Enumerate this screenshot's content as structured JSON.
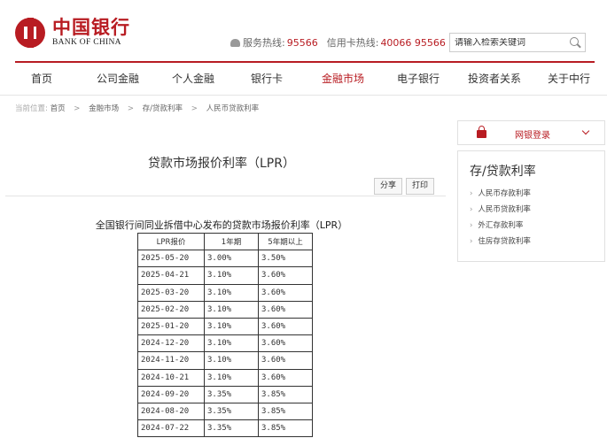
{
  "header": {
    "logo_cn": "中国银行",
    "logo_en": "BANK OF CHINA",
    "service_label": "服务热线:",
    "service_number": "95566",
    "card_label": "信用卡热线:",
    "card_number": "40066 95566",
    "search_placeholder": "请输入检索关键词"
  },
  "nav": [
    "首页",
    "公司金融",
    "个人金融",
    "银行卡",
    "金融市场",
    "电子银行",
    "投资者关系",
    "关于中行"
  ],
  "breadcrumb": {
    "prefix": "当前位置:",
    "items": [
      "首页",
      "金融市场",
      "存/贷款利率",
      "人民币贷款利率"
    ]
  },
  "main": {
    "title": "贷款市场报价利率（LPR）",
    "share": "分享",
    "print": "打印",
    "table_caption": "全国银行间同业拆借中心发布的贷款市场报价利率（LPR）",
    "headers": [
      "LPR报价",
      "1年期",
      "5年期以上"
    ],
    "rows": [
      [
        "2025-05-20",
        "3.00%",
        "3.50%"
      ],
      [
        "2025-04-21",
        "3.10%",
        "3.60%"
      ],
      [
        "2025-03-20",
        "3.10%",
        "3.60%"
      ],
      [
        "2025-02-20",
        "3.10%",
        "3.60%"
      ],
      [
        "2025-01-20",
        "3.10%",
        "3.60%"
      ],
      [
        "2024-12-20",
        "3.10%",
        "3.60%"
      ],
      [
        "2024-11-20",
        "3.10%",
        "3.60%"
      ],
      [
        "2024-10-21",
        "3.10%",
        "3.60%"
      ],
      [
        "2024-09-20",
        "3.35%",
        "3.85%"
      ],
      [
        "2024-08-20",
        "3.35%",
        "3.85%"
      ],
      [
        "2024-07-22",
        "3.35%",
        "3.85%"
      ]
    ]
  },
  "sidebar": {
    "login_label": "网银登录",
    "title": "存/贷款利率",
    "items": [
      "人民币存款利率",
      "人民币贷款利率",
      "外汇存款利率",
      "住房存贷款利率"
    ]
  },
  "colors": {
    "brand_red": "#b81c22"
  }
}
